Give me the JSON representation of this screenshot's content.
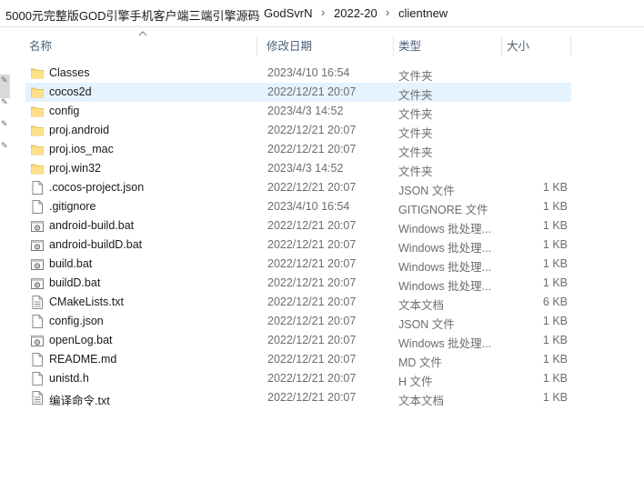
{
  "breadcrumb": {
    "items": [
      "5000元完整版GOD引擎手机客户端三端引擎源码",
      "GodSvrN",
      "2022-20",
      "clientnew"
    ]
  },
  "columns": {
    "name": "名称",
    "date": "修改日期",
    "type": "类型",
    "size": "大小"
  },
  "files": [
    {
      "name": "Classes",
      "date": "2023/4/10 16:54",
      "type": "文件夹",
      "size": "",
      "icon": "folder-icon"
    },
    {
      "name": "cocos2d",
      "date": "2022/12/21 20:07",
      "type": "文件夹",
      "size": "",
      "icon": "folder-icon"
    },
    {
      "name": "config",
      "date": "2023/4/3 14:52",
      "type": "文件夹",
      "size": "",
      "icon": "folder-icon"
    },
    {
      "name": "proj.android",
      "date": "2022/12/21 20:07",
      "type": "文件夹",
      "size": "",
      "icon": "folder-icon"
    },
    {
      "name": "proj.ios_mac",
      "date": "2022/12/21 20:07",
      "type": "文件夹",
      "size": "",
      "icon": "folder-icon"
    },
    {
      "name": "proj.win32",
      "date": "2023/4/3 14:52",
      "type": "文件夹",
      "size": "",
      "icon": "folder-icon"
    },
    {
      "name": ".cocos-project.json",
      "date": "2022/12/21 20:07",
      "type": "JSON 文件",
      "size": "1 KB",
      "icon": "file-icon"
    },
    {
      "name": ".gitignore",
      "date": "2023/4/10 16:54",
      "type": "GITIGNORE 文件",
      "size": "1 KB",
      "icon": "file-icon"
    },
    {
      "name": "android-build.bat",
      "date": "2022/12/21 20:07",
      "type": "Windows 批处理...",
      "size": "1 KB",
      "icon": "batch-file-icon"
    },
    {
      "name": "android-buildD.bat",
      "date": "2022/12/21 20:07",
      "type": "Windows 批处理...",
      "size": "1 KB",
      "icon": "batch-file-icon"
    },
    {
      "name": "build.bat",
      "date": "2022/12/21 20:07",
      "type": "Windows 批处理...",
      "size": "1 KB",
      "icon": "batch-file-icon"
    },
    {
      "name": "buildD.bat",
      "date": "2022/12/21 20:07",
      "type": "Windows 批处理...",
      "size": "1 KB",
      "icon": "batch-file-icon"
    },
    {
      "name": "CMakeLists.txt",
      "date": "2022/12/21 20:07",
      "type": "文本文档",
      "size": "6 KB",
      "icon": "text-file-icon"
    },
    {
      "name": "config.json",
      "date": "2022/12/21 20:07",
      "type": "JSON 文件",
      "size": "1 KB",
      "icon": "file-icon"
    },
    {
      "name": "openLog.bat",
      "date": "2022/12/21 20:07",
      "type": "Windows 批处理...",
      "size": "1 KB",
      "icon": "batch-file-icon"
    },
    {
      "name": "README.md",
      "date": "2022/12/21 20:07",
      "type": "MD 文件",
      "size": "1 KB",
      "icon": "file-icon"
    },
    {
      "name": "unistd.h",
      "date": "2022/12/21 20:07",
      "type": "H 文件",
      "size": "1 KB",
      "icon": "file-icon"
    },
    {
      "name": "编译命令.txt",
      "date": "2022/12/21 20:07",
      "type": "文本文档",
      "size": "1 KB",
      "icon": "text-file-icon"
    }
  ],
  "selected_index": 1,
  "colors": {
    "selection": "#e5f3ff",
    "folder": "#f8d775",
    "header_text": "#4c607a"
  }
}
